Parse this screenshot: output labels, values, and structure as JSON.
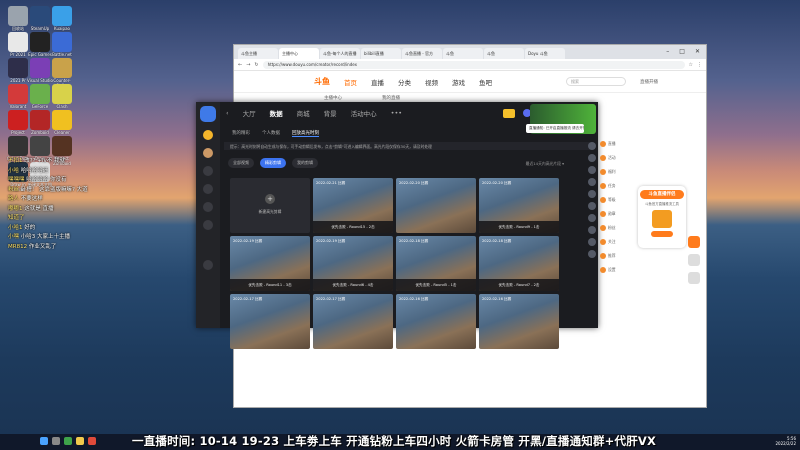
{
  "desktop": {
    "icons": [
      {
        "label": "回收站",
        "color": "#9aa3ad"
      },
      {
        "label": "SteamUp",
        "color": "#2a4a7a"
      },
      {
        "label": "Kuaipao",
        "color": "#3aa0e8"
      },
      {
        "label": "Pr 2021",
        "color": "#e8e8e8"
      },
      {
        "label": "Epic Games",
        "color": "#222"
      },
      {
        "label": "Battle.net",
        "color": "#3b6bd6"
      },
      {
        "label": "2021 Pr",
        "color": "#2e2e4a"
      },
      {
        "label": "Visual Studio",
        "color": "#7b3fb5"
      },
      {
        "label": "Counter-Strike",
        "color": "#c9a24a"
      },
      {
        "label": "Valorant",
        "color": "#d33a3a"
      },
      {
        "label": "GeForce",
        "color": "#6ab04c"
      },
      {
        "label": "Clash",
        "color": "#d8d24a"
      },
      {
        "label": "Project",
        "color": "#cc2020"
      },
      {
        "label": "Zomboid",
        "color": "#b32626"
      },
      {
        "label": "Cleaner",
        "color": "#f0c020"
      },
      {
        "label": "Cal of Duty Modern...",
        "color": "#333"
      },
      {
        "label": "Draw",
        "color": "#444"
      },
      {
        "label": "Project Zomboid",
        "color": "#553322"
      },
      {
        "label": "Draw in Ocean",
        "color": "#223344"
      },
      {
        "label": "新建文本文档",
        "color": "#e0e0e0"
      }
    ],
    "chat": [
      {
        "name": "不扣1",
        "text": "改?? +lv不 我就"
      },
      {
        "name": "小哈",
        "text": "哈哈哈哈还"
      },
      {
        "name": "嘿嘿嘿",
        "text": "哈哈哈哈 你没有"
      },
      {
        "name": "粉丝",
        "text": "卧槽！ 这靠盗版嘛嘛? 大道"
      },
      {
        "name": "路人",
        "text": "不要这样"
      },
      {
        "name": "嘟嘟1",
        "text": "这就是 直播"
      },
      {
        "name": "知道了",
        "text": ""
      },
      {
        "name": "小哈1",
        "text": "好的"
      },
      {
        "name": "小嘿",
        "text": "小哈3 大家上十主播"
      },
      {
        "name": "MR812",
        "text": "作业又乱了"
      }
    ]
  },
  "browser": {
    "tabs": [
      "斗鱼主播",
      "主播中心",
      "斗鱼-每个人的直播",
      "bilibili直播",
      "斗鱼直播 - 官方",
      "斗鱼",
      "斗鱼",
      "Doyu 斗鱼"
    ],
    "url": "https://www.douyu.com/creator/record/index",
    "site_logo": "斗鱼",
    "nav": [
      "首页",
      "直播",
      "分类",
      "视频",
      "游戏",
      "鱼吧"
    ],
    "nav_active": "首页",
    "search_placeholder": "搜索",
    "user": "直播开播",
    "subnav": [
      "主播中心",
      "我的直播"
    ]
  },
  "app": {
    "topnav": [
      "大厅",
      "数据",
      "商城",
      "背景",
      "活动中心"
    ],
    "topnav_active": "数据",
    "more_label": "•••",
    "user_name": "SheSE工...",
    "tooltip": "直播通知: 已开启直播推流 请去开播",
    "subtabs": [
      "我的精彩",
      "个人数据",
      "回放高光时刻"
    ],
    "subtab_active": "回放高光时刻",
    "info": "提示：高光时刻将自动生成与保存，可手动剪辑后发布，点击\"剪辑\"可进入编辑界面。高光片段仅保存30天，请及时处理",
    "filters": [
      "全部视频",
      "精彩剪辑",
      "我的剪辑"
    ],
    "filter_active": "精彩剪辑",
    "filter_right": "最近14天内高光片段 ▾",
    "blank_card_label": "新建高光剪辑",
    "cards": [
      {
        "date": "",
        "title": "",
        "blank": true
      },
      {
        "date": "2022-02-21 比赛",
        "title": "优先击败 - Round15 - 2击",
        "blank": false
      },
      {
        "date": "2022-02-20 比赛",
        "title": "",
        "blank": false
      },
      {
        "date": "2022-02-20 比赛",
        "title": "优先击败 - Round9 - 1击",
        "blank": false
      },
      {
        "date": "2022-02-19 比赛",
        "title": "优先击败 - Round11 - 3击",
        "blank": false
      },
      {
        "date": "2022-02-19 比赛",
        "title": "优先击败 - Round6 - 4击",
        "blank": false
      },
      {
        "date": "2022-02-18 比赛",
        "title": "优先击败 - Round5 - 1击",
        "blank": false
      },
      {
        "date": "2022-02-18 比赛",
        "title": "优先击败 - Round7 - 2击",
        "blank": false
      },
      {
        "date": "2022-02-17 比赛",
        "title": "",
        "blank": false
      },
      {
        "date": "2022-02-17 比赛",
        "title": "",
        "blank": false
      },
      {
        "date": "2022-02-16 比赛",
        "title": "",
        "blank": false
      },
      {
        "date": "2022-02-16 比赛",
        "title": "",
        "blank": false
      }
    ]
  },
  "orange_col": [
    "直播",
    "活动",
    "福利",
    "任务",
    "等级",
    "勋章",
    "粉丝",
    "关注",
    "推荐",
    "设置"
  ],
  "promo": {
    "title": "斗鱼直播伴侣",
    "subtitle": "斗鱼官方直播推流工具",
    "button": "立即下载"
  },
  "ticker": "一直播时间: 10-14 19-23 上车劵上车 开通钻粉上车四小时 火箭卡房管 开黑/直播通知群+代肝VX",
  "tray": {
    "time": "5:56",
    "date": "2022/2/22"
  },
  "colors": {
    "accent": "#ff6a00",
    "app_bg": "#1b1c20",
    "filter_active": "#3c73f0"
  }
}
